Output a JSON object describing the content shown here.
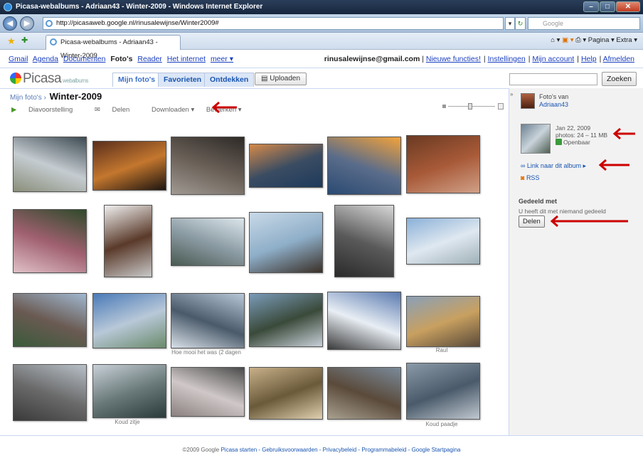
{
  "browser": {
    "title": "Picasa-webalbums - Adriaan43 - Winter-2009 - Windows Internet Explorer",
    "url": "http://picasaweb.google.nl/rinusalewijnse/Winter2009#",
    "search_placeholder": "Google",
    "tab_title": "Picasa-webalbums - Adriaan43 - Winter-2009",
    "tab_tools": "Pagina ▾   Extra ▾"
  },
  "google_bar": {
    "links": [
      "Gmail",
      "Agenda",
      "Documenten"
    ],
    "current": "Foto's",
    "links2": [
      "Reader",
      "Het internet",
      "meer ▾"
    ],
    "email": "rinusalewijnse@gmail.com",
    "right_links": [
      "Nieuwe functies!",
      "Instellingen",
      "Mijn account",
      "Help",
      "Afmelden"
    ]
  },
  "picasa": {
    "logo": "Picasa",
    "logo_sub": "webalbums",
    "tabs": [
      "Mijn foto's",
      "Favorieten",
      "Ontdekken"
    ],
    "upload": "Uploaden",
    "search_button": "Zoeken"
  },
  "album": {
    "breadcrumb": "Mijn foto's",
    "title": "Winter-2009",
    "actions": [
      "Diavoorstelling",
      "Delen",
      "Downloaden ▾",
      "Bewerken ▾"
    ]
  },
  "photos": [
    {
      "colors": [
        "#3d4a52",
        "#c5ccd1",
        "#8a8f7a"
      ]
    },
    {
      "colors": [
        "#5a2e1c",
        "#c4772e",
        "#1c1410"
      ]
    },
    {
      "colors": [
        "#2e2a26",
        "#6a6058",
        "#a09a92"
      ]
    },
    {
      "colors": [
        "#d58a4a",
        "#3a4c62",
        "#1e3a5c"
      ]
    },
    {
      "colors": [
        "#f2a23a",
        "#5a6c8a",
        "#2a4a72"
      ]
    },
    {
      "colors": [
        "#6a3a22",
        "#a85a38",
        "#d0a088"
      ]
    },
    {
      "colors": [
        "#2e4a2a",
        "#a06070",
        "#e0c0c8"
      ]
    },
    {
      "colors": [
        "#f0f0f0",
        "#5a3a2a",
        "#c8c8c8"
      ]
    },
    {
      "colors": [
        "#dce6ec",
        "#8a9aa2",
        "#4a5a52"
      ]
    },
    {
      "colors": [
        "#c9d9e8",
        "#8eaec8",
        "#3a3028"
      ]
    },
    {
      "colors": [
        "#d8d8d8",
        "#5a5a5a",
        "#2a2a2a"
      ]
    },
    {
      "colors": [
        "#8ab0d8",
        "#dfe8f0",
        "#a0b0b8"
      ]
    },
    {
      "colors": [
        "#a0b8d0",
        "#6a5a52",
        "#3a5a3a"
      ]
    },
    {
      "colors": [
        "#4a7ab8",
        "#b8c8d8",
        "#6a8a6a"
      ]
    },
    {
      "colors": [
        "#b8c8d8",
        "#4a5a6a",
        "#d8e0e8"
      ]
    },
    {
      "colors": [
        "#7a9ab8",
        "#3a4a3a",
        "#c8d0d8"
      ]
    },
    {
      "colors": [
        "#5a7ab0",
        "#e8eef4",
        "#3a3a3a"
      ]
    },
    {
      "colors": [
        "#8aa0b8",
        "#c8a060",
        "#5a4a3a"
      ]
    },
    {
      "colors": [
        "#b8c0c8",
        "#6a6a6a",
        "#3a3a3a"
      ]
    },
    {
      "colors": [
        "#c8d0d8",
        "#6a7a7a",
        "#2a3a3a"
      ]
    },
    {
      "colors": [
        "#4a4a4a",
        "#d0c8c8",
        "#8a8080"
      ]
    },
    {
      "colors": [
        "#c8b08a",
        "#6a5a3a",
        "#e0d0b0"
      ]
    },
    {
      "colors": [
        "#7a8a9a",
        "#5a4a3a",
        "#a8a090"
      ]
    },
    {
      "colors": [
        "#8a9aa8",
        "#4a5a6a",
        "#c0c8d0"
      ]
    }
  ],
  "captions": {
    "c14": "Hoe mooi het was (2 dagen",
    "c17": "Raul",
    "c19": "Koud zitje",
    "c23": "Koud paadje"
  },
  "sidebar": {
    "owner_label": "Foto's van",
    "owner_name": "Adriaan43",
    "date": "Jan 22, 2009",
    "photos_info": "photos: 24 – 11 MB",
    "visibility": "Openbaar",
    "link": "Link naar dit album ▸",
    "rss": "RSS",
    "shared_title": "Gedeeld met",
    "shared_text": "U heeft dit met niemand gedeeld",
    "share_button": "Delen"
  },
  "footer": {
    "copyright": "©2009 Google",
    "links": "Picasa starten - Gebruiksvoorwaarden - Privacybeleid - Programmabeleid - Google Startpagina"
  },
  "accent_color": "#cc0000"
}
